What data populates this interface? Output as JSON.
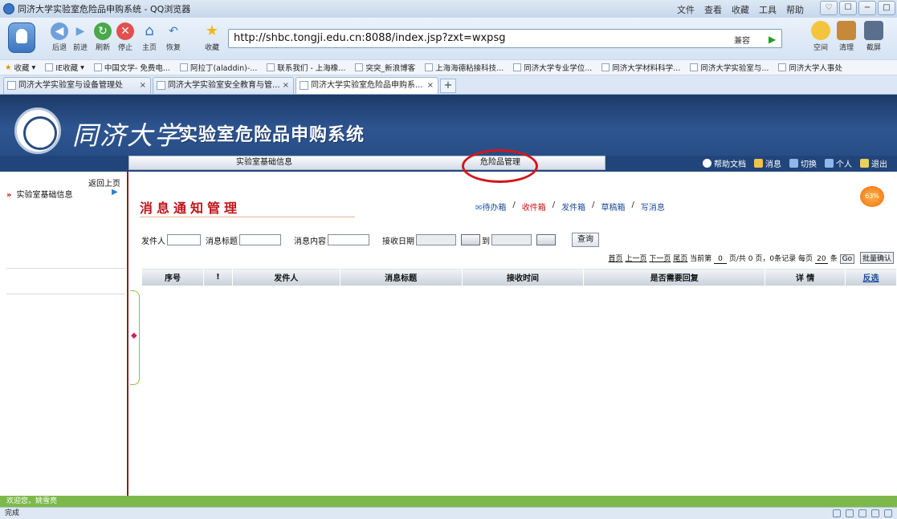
{
  "browser": {
    "window_title": "同济大学实验室危险品申购系统 - QQ浏览器",
    "menus": [
      "文件",
      "查看",
      "收藏",
      "工具",
      "帮助"
    ],
    "nav_buttons": [
      "后退",
      "前进",
      "刷新",
      "停止",
      "主页",
      "恢复",
      "收藏"
    ],
    "url": "http://shbc.tongji.edu.cn:8088/index.jsp?zxt=wxpsg",
    "compat_label": "兼容",
    "right_tools": [
      "空间",
      "清理",
      "截屏"
    ],
    "favorites": [
      "收藏",
      "IE收藏",
      "中国文学- 免费电...",
      "阿拉丁(aladdin)-...",
      "联系我们 - 上海橡...",
      "突突_新浪博客",
      "上海海德粘接科技...",
      "同济大学专业学位...",
      "同济大学材料科学...",
      "同济大学实验室与...",
      "同济大学人事处"
    ],
    "tabs": [
      {
        "label": "同济大学实验室与设备管理处"
      },
      {
        "label": "同济大学实验室安全教育与管..."
      },
      {
        "label": "同济大学实验室危险品申购系..."
      }
    ],
    "status": "完成"
  },
  "site": {
    "university": "同济大学",
    "system_name": "实验室危险品申购系统",
    "nav_tabs": [
      "实验室基础信息",
      "危险品管理"
    ],
    "header_links": [
      "帮助文档",
      "消息",
      "切换",
      "个人",
      "退出"
    ],
    "welcome": "欢迎您，姚雪亮"
  },
  "sidebar": {
    "back_link": "返回上页",
    "item": "实验室基础信息"
  },
  "main": {
    "title": "消息通知管理",
    "message_nav": [
      "待办箱",
      "收件箱",
      "发件箱",
      "草稿箱",
      "写消息"
    ],
    "filters": {
      "sender_label": "发件人",
      "subject_label": "消息标题",
      "content_label": "消息内容",
      "date_label": "接收日期",
      "to_label": "到",
      "query_button": "查询"
    },
    "pager": {
      "first": "首页",
      "prev": "上一页",
      "next": "下一页",
      "last": "尾页",
      "current_prefix": "当前第",
      "current": "0",
      "total_text": "页/共 0 页，0条记录",
      "per_page_prefix": "每页",
      "per_page": "20",
      "per_page_suffix": "条",
      "go": "Go",
      "batch": "批量确认"
    },
    "columns": [
      "序号",
      "!",
      "发件人",
      "消息标题",
      "接收时间",
      "是否需要回复",
      "详 情",
      "反选"
    ]
  },
  "floater": "63%"
}
